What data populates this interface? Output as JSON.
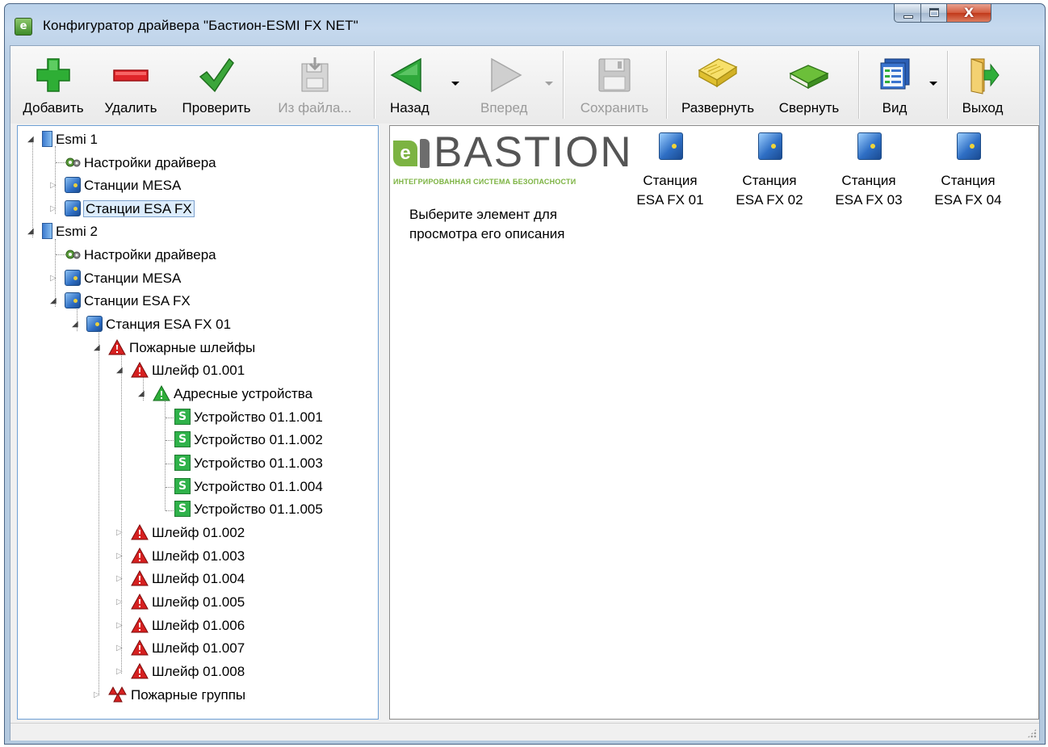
{
  "window": {
    "title": "Конфигуратор драйвера \"Бастион-ESMI FX NET\"",
    "close_glyph": "X"
  },
  "toolbar": {
    "add": "Добавить",
    "delete": "Удалить",
    "check": "Проверить",
    "from_file": "Из файла...",
    "back": "Назад",
    "forward": "Вперед",
    "save": "Сохранить",
    "expand": "Развернуть",
    "collapse": "Свернуть",
    "view": "Вид",
    "exit": "Выход"
  },
  "tree": {
    "nodes": [
      {
        "label": "Esmi 1"
      },
      {
        "label": "Настройки драйвера"
      },
      {
        "label": "Станции MESA"
      },
      {
        "label": "Станции ESA FX",
        "selected": true
      },
      {
        "label": "Esmi 2"
      },
      {
        "label": "Настройки драйвера"
      },
      {
        "label": "Станции MESA"
      },
      {
        "label": "Станции ESA FX"
      },
      {
        "label": "Станция ESA FX 01"
      },
      {
        "label": "Пожарные шлейфы"
      },
      {
        "label": "Шлейф 01.001"
      },
      {
        "label": "Адресные устройства"
      },
      {
        "label": "Устройство 01.1.001"
      },
      {
        "label": "Устройство 01.1.002"
      },
      {
        "label": "Устройство 01.1.003"
      },
      {
        "label": "Устройство 01.1.004"
      },
      {
        "label": "Устройство 01.1.005"
      },
      {
        "label": "Шлейф 01.002"
      },
      {
        "label": "Шлейф 01.003"
      },
      {
        "label": "Шлейф 01.004"
      },
      {
        "label": "Шлейф 01.005"
      },
      {
        "label": "Шлейф 01.006"
      },
      {
        "label": "Шлейф 01.007"
      },
      {
        "label": "Шлейф 01.008"
      },
      {
        "label": "Пожарные группы"
      }
    ]
  },
  "right": {
    "logo_word": "BASTION",
    "logo_letter": "e",
    "logo_sub": "ИНТЕГРИРОВАННАЯ СИСТЕМА БЕЗОПАСНОСТИ",
    "hint": "Выберите элемент для просмотра его описания",
    "stations": [
      {
        "line1": "Станция",
        "line2": "ESA FX 01"
      },
      {
        "line1": "Станция",
        "line2": "ESA FX 02"
      },
      {
        "line1": "Станция",
        "line2": "ESA FX 03"
      },
      {
        "line1": "Станция",
        "line2": "ESA FX 04"
      }
    ]
  },
  "colors": {
    "accent": "#2f6fc5",
    "fire_red": "#cc1f1f",
    "device_green": "#2fb24a"
  }
}
